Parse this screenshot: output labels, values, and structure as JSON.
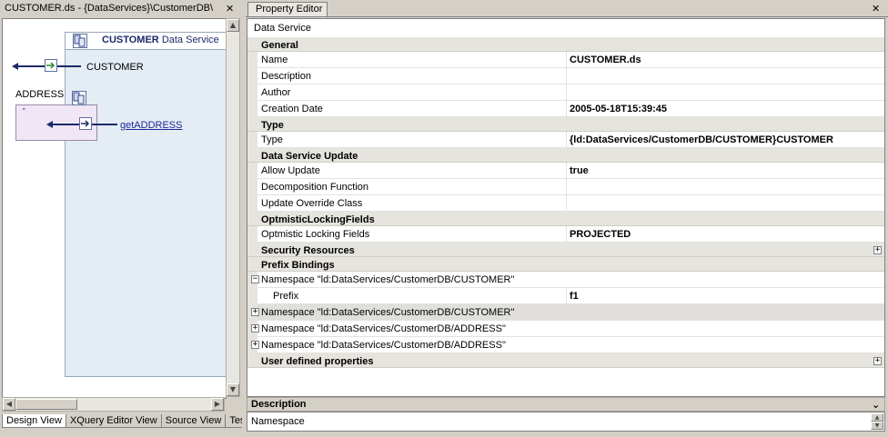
{
  "left_panel": {
    "title": "CUSTOMER.ds - {DataServices}\\CustomerDB\\",
    "diagram": {
      "service_name": "CUSTOMER",
      "service_type": "Data Service",
      "return_type": "CUSTOMER",
      "relationship_label": "ADDRESS",
      "relationship_function": "getADDRESS"
    },
    "tabs": [
      "Design View",
      "XQuery Editor View",
      "Source View",
      "Tes"
    ]
  },
  "property_editor": {
    "tab_label": "Property Editor",
    "heading": "Data Service",
    "rows": [
      {
        "kind": "cat",
        "key": "General"
      },
      {
        "kind": "prop",
        "key": "Name",
        "value": "CUSTOMER.ds"
      },
      {
        "kind": "prop",
        "key": "Description",
        "value": ""
      },
      {
        "kind": "prop",
        "key": "Author",
        "value": ""
      },
      {
        "kind": "prop",
        "key": "Creation Date",
        "value": "2005-05-18T15:39:45"
      },
      {
        "kind": "cat",
        "key": "Type"
      },
      {
        "kind": "prop",
        "key": "Type",
        "value": "{ld:DataServices/CustomerDB/CUSTOMER}CUSTOMER"
      },
      {
        "kind": "cat",
        "key": "Data Service Update"
      },
      {
        "kind": "prop",
        "key": "Allow Update",
        "value": "true"
      },
      {
        "kind": "prop",
        "key": "Decomposition Function",
        "value": ""
      },
      {
        "kind": "prop",
        "key": "Update Override Class",
        "value": ""
      },
      {
        "kind": "cat",
        "key": "OptmisticLockingFields"
      },
      {
        "kind": "prop",
        "key": "Optmistic Locking Fields",
        "value": "PROJECTED"
      },
      {
        "kind": "cat",
        "key": "Security Resources"
      },
      {
        "kind": "cat",
        "key": "Prefix Bindings"
      },
      {
        "kind": "ns",
        "key": "Namespace \"ld:DataServices/CustomerDB/CUSTOMER\""
      },
      {
        "kind": "sub",
        "key": "Prefix",
        "value": "f1"
      },
      {
        "kind": "ns",
        "key": "Namespace \"ld:DataServices/CustomerDB/CUSTOMER\""
      },
      {
        "kind": "ns",
        "key": "Namespace \"ld:DataServices/CustomerDB/ADDRESS\""
      },
      {
        "kind": "ns",
        "key": "Namespace \"ld:DataServices/CustomerDB/ADDRESS\""
      },
      {
        "kind": "cat",
        "key": "User defined properties"
      }
    ],
    "description_title": "Description",
    "description_text": "Namespace"
  }
}
